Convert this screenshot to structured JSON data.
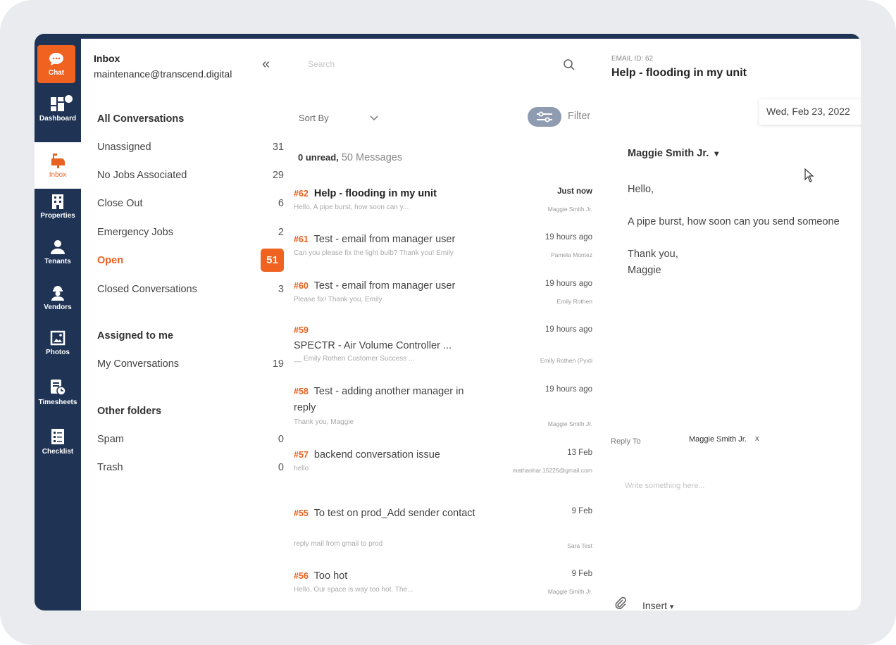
{
  "nav": {
    "items": [
      {
        "label": "Chat",
        "icon": "chat-icon"
      },
      {
        "label": "Dashboard",
        "icon": "dashboard-icon"
      },
      {
        "label": "Inbox",
        "icon": "mailbox-icon"
      },
      {
        "label": "Properties",
        "icon": "building-icon"
      },
      {
        "label": "Tenants",
        "icon": "person-icon"
      },
      {
        "label": "Vendors",
        "icon": "worker-icon"
      },
      {
        "label": "Photos",
        "icon": "photo-icon"
      },
      {
        "label": "Timesheets",
        "icon": "timesheet-icon"
      },
      {
        "label": "Checklist",
        "icon": "checklist-icon"
      }
    ]
  },
  "folders": {
    "title": "Inbox",
    "email": "maintenance@transcend.digital",
    "collapse_glyph": "«",
    "all_conversations_heading": "All Conversations",
    "items": [
      {
        "label": "Unassigned",
        "count": "31"
      },
      {
        "label": "No Jobs Associated",
        "count": "29"
      },
      {
        "label": "Close Out",
        "count": "6"
      },
      {
        "label": "Emergency Jobs",
        "count": "2"
      },
      {
        "label": "Open",
        "count": "51"
      },
      {
        "label": "Closed Conversations",
        "count": "3"
      }
    ],
    "assigned_heading": "Assigned to me",
    "assigned_items": [
      {
        "label": "My Conversations",
        "count": "19"
      }
    ],
    "other_heading": "Other folders",
    "other_items": [
      {
        "label": "Spam",
        "count": "0"
      },
      {
        "label": "Trash",
        "count": "0"
      }
    ]
  },
  "list": {
    "search_placeholder": "Search",
    "sort_label": "Sort By",
    "filter_label": "Filter",
    "unread_text": "0 unread,",
    "messages_text": "50 Messages",
    "messages": [
      {
        "num": "#62",
        "subject": "Help - flooding in my unit",
        "time": "Just now",
        "preview": "Hello, A pipe burst, how soon can y...",
        "sender": "Maggie Smith Jr."
      },
      {
        "num": "#61",
        "subject": "Test - email from manager user",
        "time": "19 hours ago",
        "preview": "Can you please fix the light bulb? Thank you! Emily",
        "sender": "Pamela Montez"
      },
      {
        "num": "#60",
        "subject": "Test - email from manager user",
        "time": "19 hours ago",
        "preview": "Please fix! Thank you, Emily",
        "sender": "Emily Rothen"
      },
      {
        "num": "#59",
        "subject": "SPECTR - Air Volume Controller ...",
        "time": "19 hours ago",
        "preview": "__ Emily Rothen Customer Success ...",
        "sender": "Emily Rothen (Pyxti"
      },
      {
        "num": "#58",
        "subject": "Test - adding another manager in reply",
        "time": "19 hours ago",
        "preview": "Thank you, Maggie",
        "sender": "Maggie Smith Jr."
      },
      {
        "num": "#57",
        "subject": "backend conversation issue",
        "time": "13 Feb",
        "preview": "hello",
        "sender": "mathanhar.15225@gmail.com"
      },
      {
        "num": "#55",
        "subject": "To test on prod_Add sender contact",
        "time": "9 Feb",
        "preview": "reply mail from gmail to prod",
        "sender": "Sara Test"
      },
      {
        "num": "#56",
        "subject": "Too hot",
        "time": "9 Feb",
        "preview": "Hello, Our space is way too hot. The...",
        "sender": "Maggie Smith Jr."
      }
    ]
  },
  "detail": {
    "email_id": "EMAIL ID: 62",
    "subject": "Help - flooding in my unit",
    "date": "Wed, Feb 23, 2022",
    "sender": "Maggie Smith Jr.",
    "dropdown_glyph": "▾",
    "body": [
      "Hello,",
      "A pipe burst, how soon can you send someone",
      "Thank you,",
      "Maggie"
    ],
    "reply_to_label": "Reply To",
    "reply_to_name": "Maggie Smith Jr.",
    "reply_remove": "x",
    "write_placeholder": "Write something here...",
    "insert_label": "Insert"
  },
  "colors": {
    "nav_bg": "#1f3354",
    "accent": "#f0621f",
    "filter_toggle": "#8e9bb0"
  }
}
